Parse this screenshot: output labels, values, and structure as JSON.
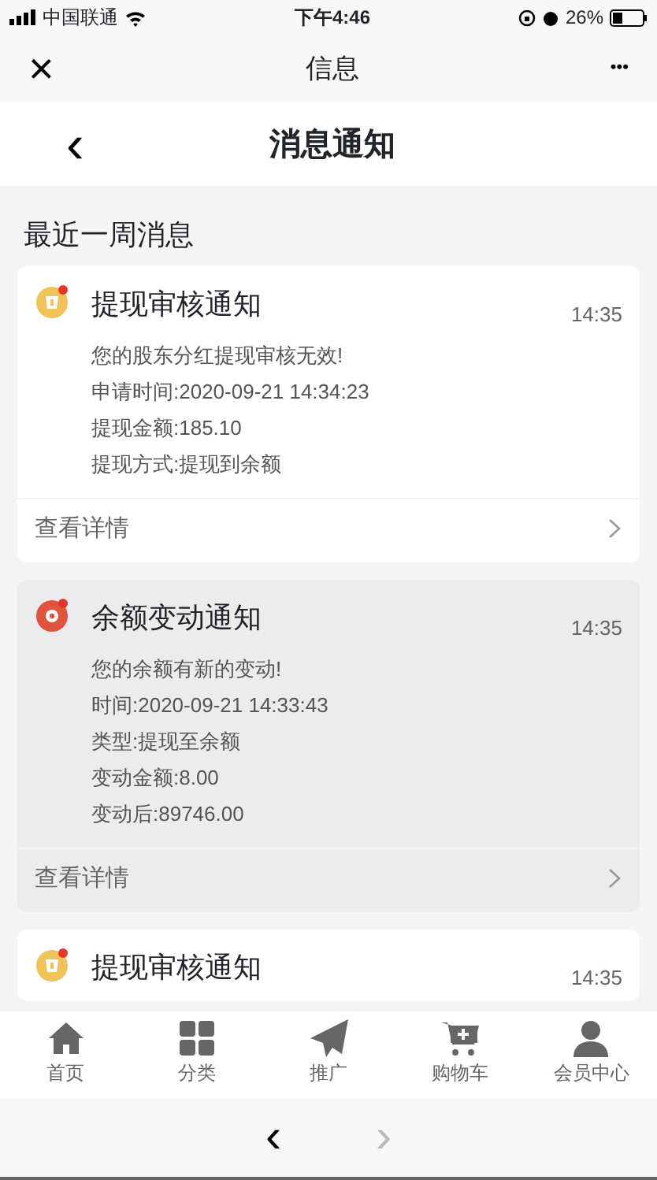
{
  "status_bar": {
    "carrier": "中国联通",
    "time": "下午4:46",
    "battery": "26%"
  },
  "wechat_bar": {
    "close": "×",
    "title": "信息",
    "more": "•••"
  },
  "header": {
    "back": "‹",
    "title": "消息通知"
  },
  "section_title": "最近一周消息",
  "messages": [
    {
      "kind": "withdraw",
      "title": "提现审核通知",
      "time": "14:35",
      "highlighted": false,
      "unread": true,
      "lines": [
        "您的股东分红提现审核无效!",
        "申请时间:2020-09-21 14:34:23",
        "提现金额:185.10",
        "提现方式:提现到余额"
      ],
      "link": "查看详情"
    },
    {
      "kind": "balance",
      "title": "余额变动通知",
      "time": "14:35",
      "highlighted": true,
      "unread": true,
      "lines": [
        "您的余额有新的变动!",
        "时间:2020-09-21 14:33:43",
        "类型:提现至余额",
        "变动金额:8.00",
        "变动后:89746.00"
      ],
      "link": "查看详情"
    },
    {
      "kind": "withdraw",
      "title": "提现审核通知",
      "time": "14:35",
      "highlighted": false,
      "unread": true
    }
  ],
  "tabbar": [
    {
      "kind": "home",
      "label": "首页"
    },
    {
      "kind": "category",
      "label": "分类"
    },
    {
      "kind": "promote",
      "label": "推广"
    },
    {
      "kind": "cart",
      "label": "购物车"
    },
    {
      "kind": "member",
      "label": "会员中心"
    }
  ],
  "browser_bar": {
    "back": "‹",
    "forward": "›",
    "forward_disabled": true
  }
}
